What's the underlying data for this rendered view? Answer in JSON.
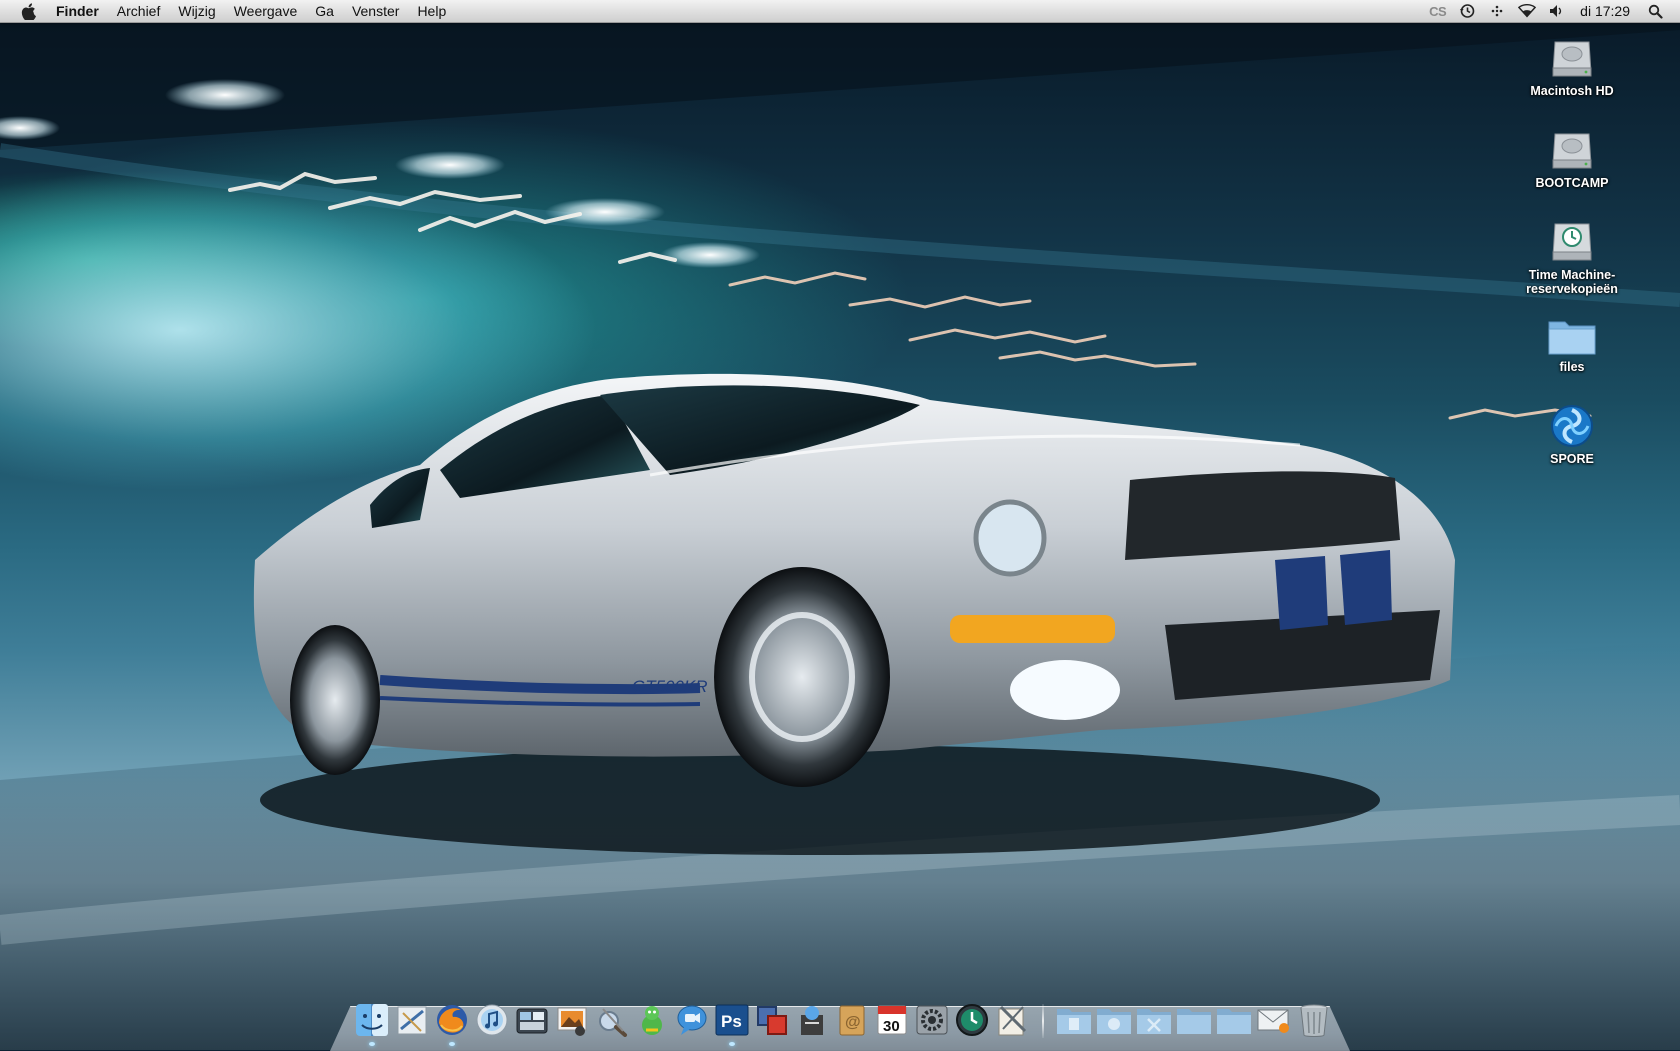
{
  "menubar": {
    "app_name": "Finder",
    "items": [
      "Archief",
      "Wijzig",
      "Weergave",
      "Ga",
      "Venster",
      "Help"
    ],
    "status_text": "CS",
    "clock": "di 17:29"
  },
  "desktop": {
    "icons": [
      {
        "label": "Macintosh HD",
        "icon": "hard-drive-icon"
      },
      {
        "label": "BOOTCAMP",
        "icon": "hard-drive-icon"
      },
      {
        "label": "Time Machine-\nreservekopieën",
        "icon": "time-machine-drive-icon"
      },
      {
        "label": "files",
        "icon": "folder-icon"
      },
      {
        "label": "SPORE",
        "icon": "spore-icon"
      }
    ]
  },
  "wallpaper": {
    "car_badge": "GT500KR"
  },
  "dock": {
    "apps": [
      "finder-icon",
      "mail-icon",
      "firefox-icon",
      "itunes-icon",
      "dashboard-icon",
      "iphoto-icon",
      "preview-icon",
      "adium-icon",
      "ichat-icon",
      "photoshop-icon",
      "parallels-icon",
      "iweb-icon",
      "address-book-icon",
      "ical-icon",
      "system-preferences-icon",
      "time-machine-icon",
      "script-editor-icon"
    ],
    "calendar_date": "30",
    "photoshop_label": "Ps",
    "stacks": [
      "documents-folder-icon",
      "downloads-folder-icon",
      "applications-folder-icon",
      "folder-icon",
      "folder-icon",
      "mail-drop-icon",
      "trash-icon"
    ]
  },
  "colors": {
    "menubar_bg": "#e3e3e3",
    "accent_stripe": "#1f3c7a"
  }
}
